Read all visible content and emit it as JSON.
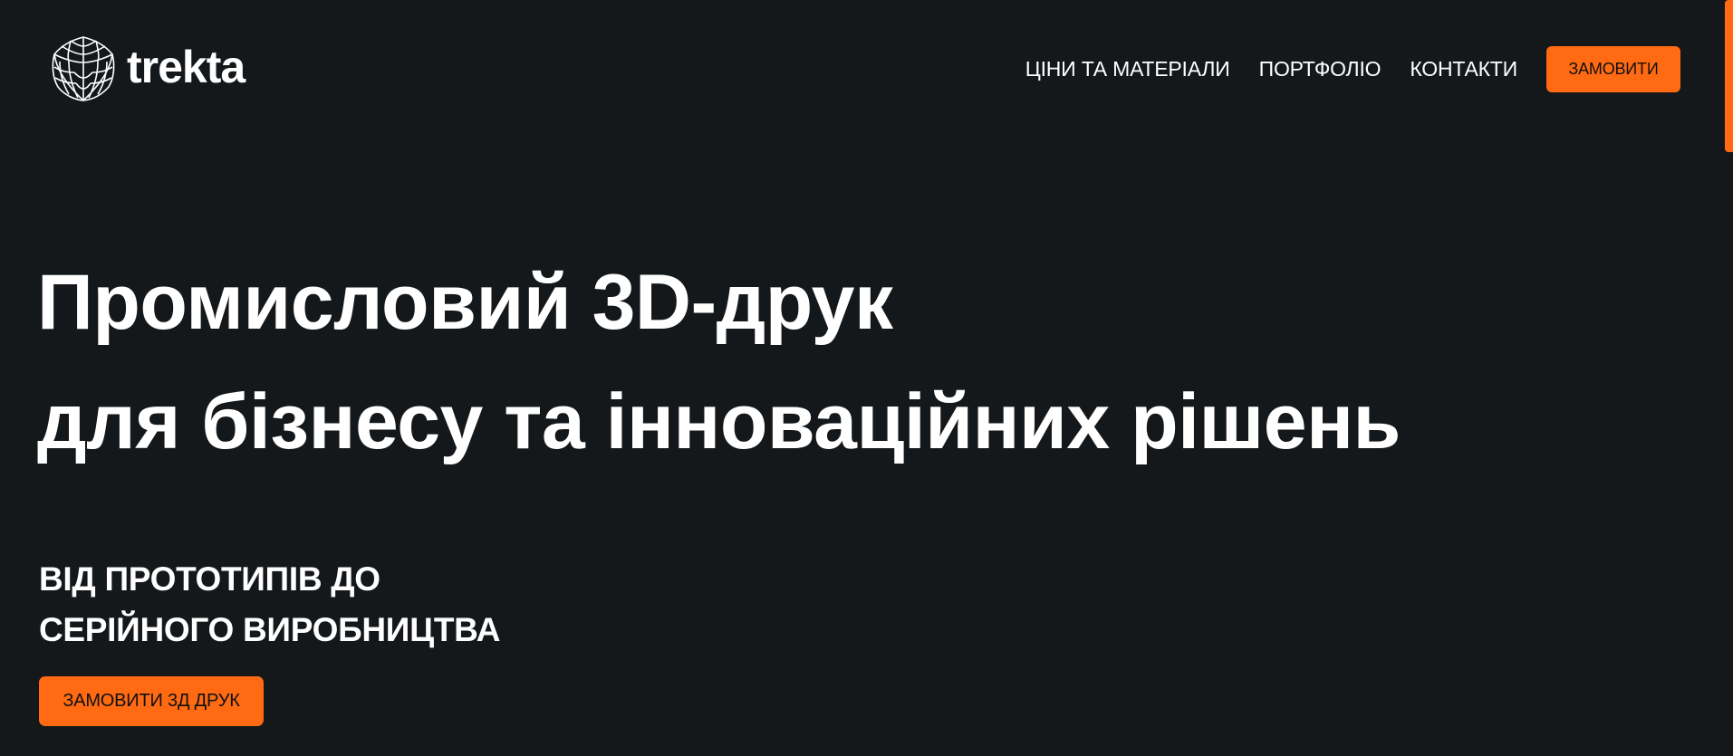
{
  "brand": {
    "name": "trekta",
    "logo_icon": "wireframe-cube-icon"
  },
  "nav": {
    "items": [
      {
        "label": "ЦІНИ ТА МАТЕРІАЛИ"
      },
      {
        "label": "ПОРТФОЛІО"
      },
      {
        "label": "КОНТАКТИ"
      }
    ],
    "cta_label": "ЗАМОВИТИ"
  },
  "hero": {
    "title_lines": [
      "Промисловий 3D-друк",
      "для бізнесу та інноваційних рішень"
    ],
    "subtitle_lines": [
      "ВІД ПРОТОТИПІВ ДО",
      "СЕРІЙНОГО ВИРОБНИЦТВА"
    ],
    "cta_label": "ЗАМОВИТИ 3Д ДРУК"
  },
  "colors": {
    "background": "#15181b",
    "accent": "#ff6a13",
    "text": "#ffffff",
    "button_text": "#111111"
  }
}
